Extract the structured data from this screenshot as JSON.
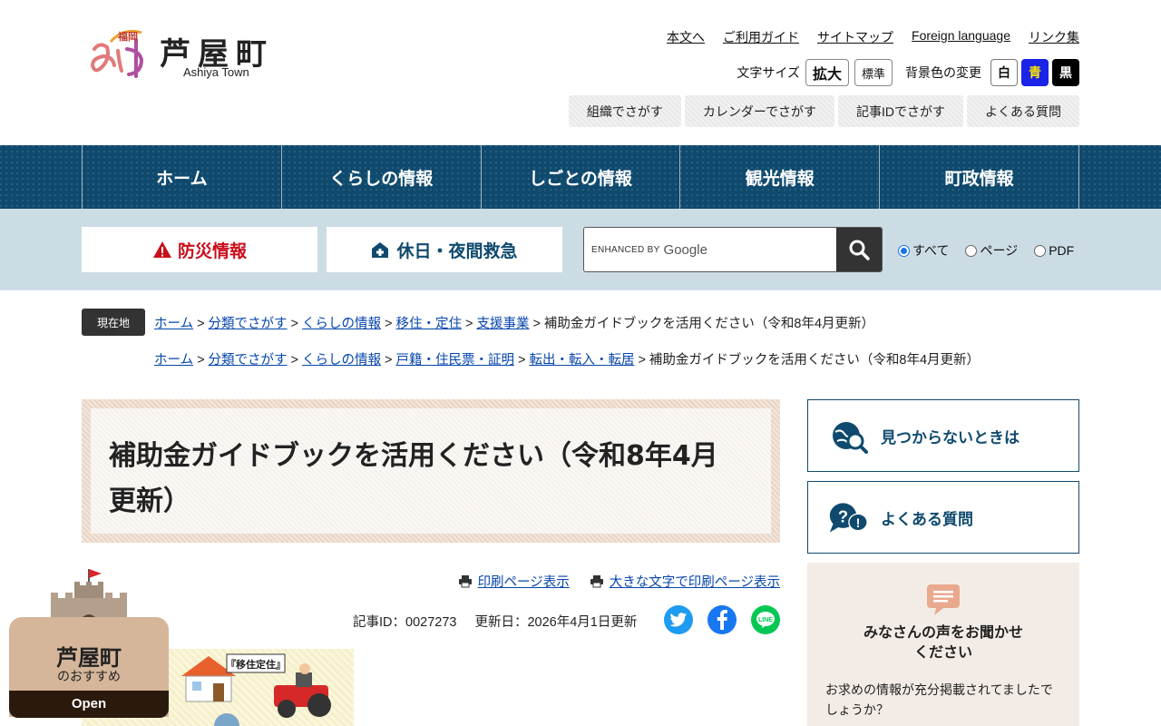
{
  "site": {
    "logo_badge": "福岡",
    "logo_script": "あしや",
    "name": "芦屋町",
    "name_en": "Ashiya Town"
  },
  "util_links": [
    "本文へ",
    "ご利用ガイド",
    "サイトマップ",
    "Foreign language",
    "リンク集"
  ],
  "font_size": {
    "label": "文字サイズ",
    "enlarge": "拡大",
    "standard": "標準"
  },
  "bg_color": {
    "label": "背景色の変更",
    "white": "白",
    "blue": "青",
    "black": "黒"
  },
  "search_tabs": [
    "組織でさがす",
    "カレンダーでさがす",
    "記事IDでさがす",
    "よくある質問"
  ],
  "gnav": [
    "ホーム",
    "くらしの情報",
    "しごとの情報",
    "観光情報",
    "町政情報"
  ],
  "band": {
    "disaster": "防災情報",
    "emergency": "休日・夜間救急",
    "search_enhanced": "ENHANCED BY",
    "search_google": "Google",
    "radio_all": "すべて",
    "radio_page": "ページ",
    "radio_pdf": "PDF"
  },
  "breadcrumb": {
    "here_label": "現在地",
    "trail1": [
      "ホーム",
      "分類でさがす",
      "くらしの情報",
      "移住・定住",
      "支援事業"
    ],
    "trail2": [
      "ホーム",
      "分類でさがす",
      "くらしの情報",
      "戸籍・住民票・証明",
      "転出・転入・転居"
    ],
    "current": "補助金ガイドブックを活用ください（令和8年4月更新）",
    "separator": ">"
  },
  "article": {
    "title": "補助金ガイドブックを活用ください（令和8年4月更新）",
    "print_link": "印刷ページ表示",
    "print_large_link": "大きな文字で印刷ページ表示",
    "article_id": "記事ID：0027273",
    "updated": "更新日：2026年4月1日更新",
    "image_tag": "『移住定住』"
  },
  "sidebar": {
    "not_found": "見つからないときは",
    "faq": "よくある質問",
    "voice_title_1": "みなさんの声をお聞かせ",
    "voice_title_2": "ください",
    "voice_body": "お求めの情報が充分掲載されてましたでしょうか？"
  },
  "recommend": {
    "title": "芦屋町",
    "sub": "のおすすめ",
    "open": "Open"
  },
  "colors": {
    "nav": "#0f4a6e",
    "band": "#ccdce4",
    "disaster": "#c8101c"
  }
}
